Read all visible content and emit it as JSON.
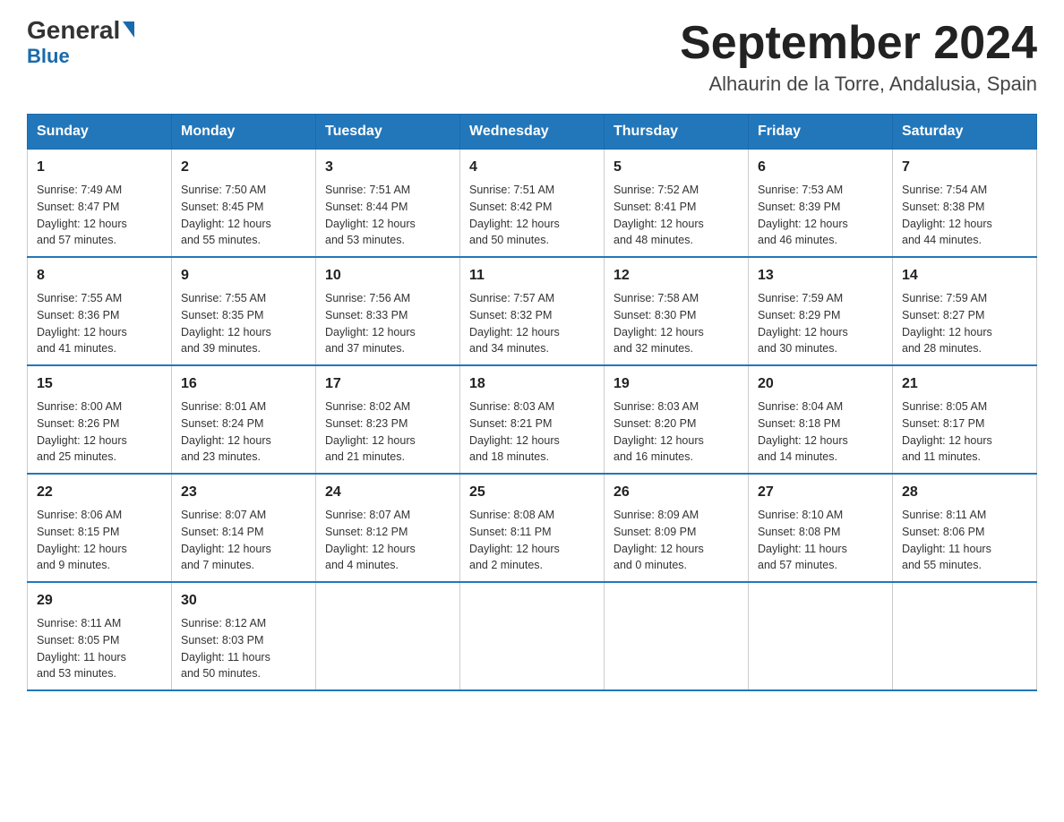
{
  "header": {
    "logo_general": "General",
    "logo_blue": "Blue",
    "month_title": "September 2024",
    "location": "Alhaurin de la Torre, Andalusia, Spain"
  },
  "weekdays": [
    "Sunday",
    "Monday",
    "Tuesday",
    "Wednesday",
    "Thursday",
    "Friday",
    "Saturday"
  ],
  "weeks": [
    [
      {
        "day": "1",
        "info": "Sunrise: 7:49 AM\nSunset: 8:47 PM\nDaylight: 12 hours\nand 57 minutes."
      },
      {
        "day": "2",
        "info": "Sunrise: 7:50 AM\nSunset: 8:45 PM\nDaylight: 12 hours\nand 55 minutes."
      },
      {
        "day": "3",
        "info": "Sunrise: 7:51 AM\nSunset: 8:44 PM\nDaylight: 12 hours\nand 53 minutes."
      },
      {
        "day": "4",
        "info": "Sunrise: 7:51 AM\nSunset: 8:42 PM\nDaylight: 12 hours\nand 50 minutes."
      },
      {
        "day": "5",
        "info": "Sunrise: 7:52 AM\nSunset: 8:41 PM\nDaylight: 12 hours\nand 48 minutes."
      },
      {
        "day": "6",
        "info": "Sunrise: 7:53 AM\nSunset: 8:39 PM\nDaylight: 12 hours\nand 46 minutes."
      },
      {
        "day": "7",
        "info": "Sunrise: 7:54 AM\nSunset: 8:38 PM\nDaylight: 12 hours\nand 44 minutes."
      }
    ],
    [
      {
        "day": "8",
        "info": "Sunrise: 7:55 AM\nSunset: 8:36 PM\nDaylight: 12 hours\nand 41 minutes."
      },
      {
        "day": "9",
        "info": "Sunrise: 7:55 AM\nSunset: 8:35 PM\nDaylight: 12 hours\nand 39 minutes."
      },
      {
        "day": "10",
        "info": "Sunrise: 7:56 AM\nSunset: 8:33 PM\nDaylight: 12 hours\nand 37 minutes."
      },
      {
        "day": "11",
        "info": "Sunrise: 7:57 AM\nSunset: 8:32 PM\nDaylight: 12 hours\nand 34 minutes."
      },
      {
        "day": "12",
        "info": "Sunrise: 7:58 AM\nSunset: 8:30 PM\nDaylight: 12 hours\nand 32 minutes."
      },
      {
        "day": "13",
        "info": "Sunrise: 7:59 AM\nSunset: 8:29 PM\nDaylight: 12 hours\nand 30 minutes."
      },
      {
        "day": "14",
        "info": "Sunrise: 7:59 AM\nSunset: 8:27 PM\nDaylight: 12 hours\nand 28 minutes."
      }
    ],
    [
      {
        "day": "15",
        "info": "Sunrise: 8:00 AM\nSunset: 8:26 PM\nDaylight: 12 hours\nand 25 minutes."
      },
      {
        "day": "16",
        "info": "Sunrise: 8:01 AM\nSunset: 8:24 PM\nDaylight: 12 hours\nand 23 minutes."
      },
      {
        "day": "17",
        "info": "Sunrise: 8:02 AM\nSunset: 8:23 PM\nDaylight: 12 hours\nand 21 minutes."
      },
      {
        "day": "18",
        "info": "Sunrise: 8:03 AM\nSunset: 8:21 PM\nDaylight: 12 hours\nand 18 minutes."
      },
      {
        "day": "19",
        "info": "Sunrise: 8:03 AM\nSunset: 8:20 PM\nDaylight: 12 hours\nand 16 minutes."
      },
      {
        "day": "20",
        "info": "Sunrise: 8:04 AM\nSunset: 8:18 PM\nDaylight: 12 hours\nand 14 minutes."
      },
      {
        "day": "21",
        "info": "Sunrise: 8:05 AM\nSunset: 8:17 PM\nDaylight: 12 hours\nand 11 minutes."
      }
    ],
    [
      {
        "day": "22",
        "info": "Sunrise: 8:06 AM\nSunset: 8:15 PM\nDaylight: 12 hours\nand 9 minutes."
      },
      {
        "day": "23",
        "info": "Sunrise: 8:07 AM\nSunset: 8:14 PM\nDaylight: 12 hours\nand 7 minutes."
      },
      {
        "day": "24",
        "info": "Sunrise: 8:07 AM\nSunset: 8:12 PM\nDaylight: 12 hours\nand 4 minutes."
      },
      {
        "day": "25",
        "info": "Sunrise: 8:08 AM\nSunset: 8:11 PM\nDaylight: 12 hours\nand 2 minutes."
      },
      {
        "day": "26",
        "info": "Sunrise: 8:09 AM\nSunset: 8:09 PM\nDaylight: 12 hours\nand 0 minutes."
      },
      {
        "day": "27",
        "info": "Sunrise: 8:10 AM\nSunset: 8:08 PM\nDaylight: 11 hours\nand 57 minutes."
      },
      {
        "day": "28",
        "info": "Sunrise: 8:11 AM\nSunset: 8:06 PM\nDaylight: 11 hours\nand 55 minutes."
      }
    ],
    [
      {
        "day": "29",
        "info": "Sunrise: 8:11 AM\nSunset: 8:05 PM\nDaylight: 11 hours\nand 53 minutes."
      },
      {
        "day": "30",
        "info": "Sunrise: 8:12 AM\nSunset: 8:03 PM\nDaylight: 11 hours\nand 50 minutes."
      },
      {
        "day": "",
        "info": ""
      },
      {
        "day": "",
        "info": ""
      },
      {
        "day": "",
        "info": ""
      },
      {
        "day": "",
        "info": ""
      },
      {
        "day": "",
        "info": ""
      }
    ]
  ]
}
